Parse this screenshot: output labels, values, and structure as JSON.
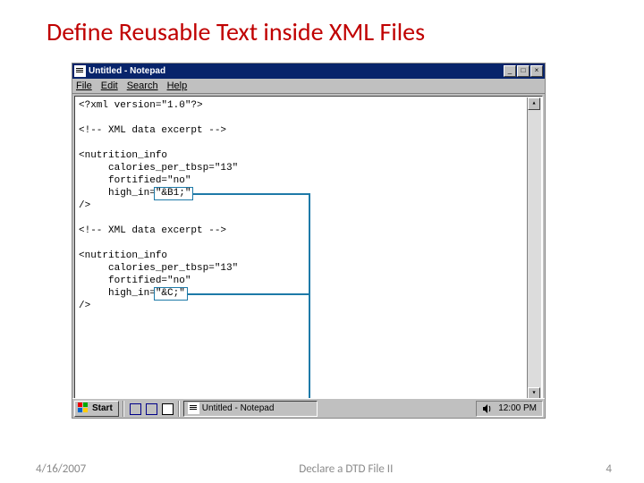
{
  "slide": {
    "title": "Define Reusable Text inside XML Files",
    "date": "4/16/2007",
    "center": "Declare a DTD File II",
    "page": "4"
  },
  "window": {
    "title": "Untitled - Notepad",
    "menus": {
      "file": "File",
      "edit": "Edit",
      "search": "Search",
      "help": "Help"
    }
  },
  "code": {
    "l1": "<?xml version=\"1.0\"?>",
    "l2": "",
    "l3": "<!-- XML data excerpt -->",
    "l4": "",
    "l5": "<nutrition_info",
    "l6": "     calories_per_tbsp=\"13\"",
    "l7": "     fortified=\"no\"",
    "l8a": "     high_in=",
    "l8b": "\"&B1;\"",
    "l9": "/>",
    "l10": "",
    "l11": "<!-- XML data excerpt -->",
    "l12": "",
    "l13": "<nutrition_info",
    "l14": "     calories_per_tbsp=\"13\"",
    "l15": "     fortified=\"no\"",
    "l16a": "     high_in=",
    "l16b": "\"&C;\"",
    "l17": "/>"
  },
  "taskbar": {
    "start": "Start",
    "task": "Untitled - Notepad",
    "clock": "12:00 PM"
  }
}
